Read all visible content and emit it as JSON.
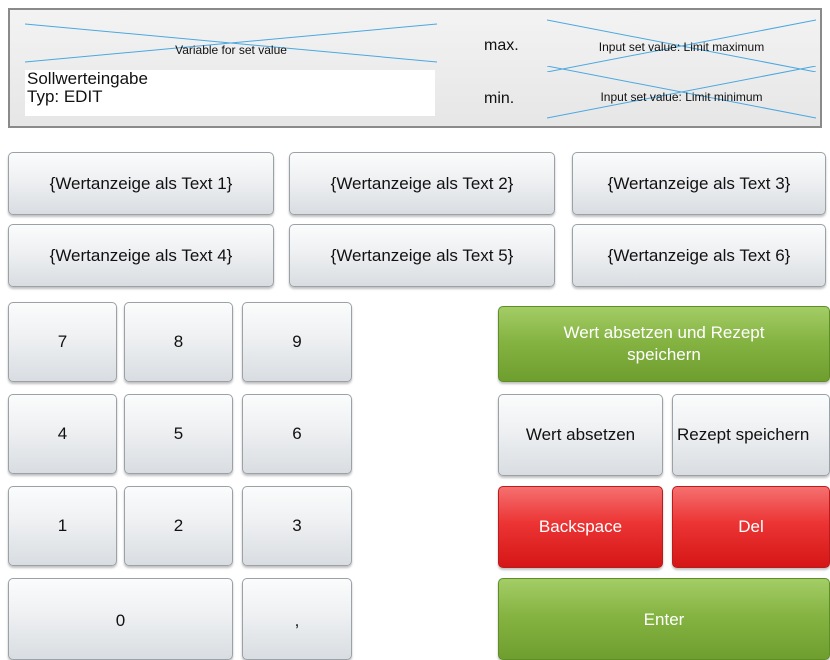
{
  "header": {
    "variable_placeholder": "Variable for set value",
    "edit_lines": [
      "Sollwerteingabe",
      "Typ: EDIT"
    ],
    "max_label": "max.",
    "min_label": "min.",
    "max_placeholder": "Input set value: Limit maximum",
    "min_placeholder": "Input set value: Limit minimum"
  },
  "text_buttons": [
    "{Wertanzeige als Text 1}",
    "{Wertanzeige als Text 2}",
    "{Wertanzeige als Text 3}",
    "{Wertanzeige als Text 4}",
    "{Wertanzeige als Text 5}",
    "{Wertanzeige als Text 6}"
  ],
  "keypad": {
    "k7": "7",
    "k8": "8",
    "k9": "9",
    "k4": "4",
    "k5": "5",
    "k6": "6",
    "k1": "1",
    "k2": "2",
    "k3": "3",
    "k0": "0",
    "comma": ","
  },
  "actions": {
    "set_and_save": "Wert absetzen und Rezept speichern",
    "set_value": "Wert absetzen",
    "save_recipe": "Rezept speichern",
    "backspace": "Backspace",
    "del": "Del",
    "enter": "Enter"
  },
  "colors": {
    "placeholder_cross": "#4aa8e0",
    "green_button": "#86b443",
    "red_button": "#ec3434"
  }
}
